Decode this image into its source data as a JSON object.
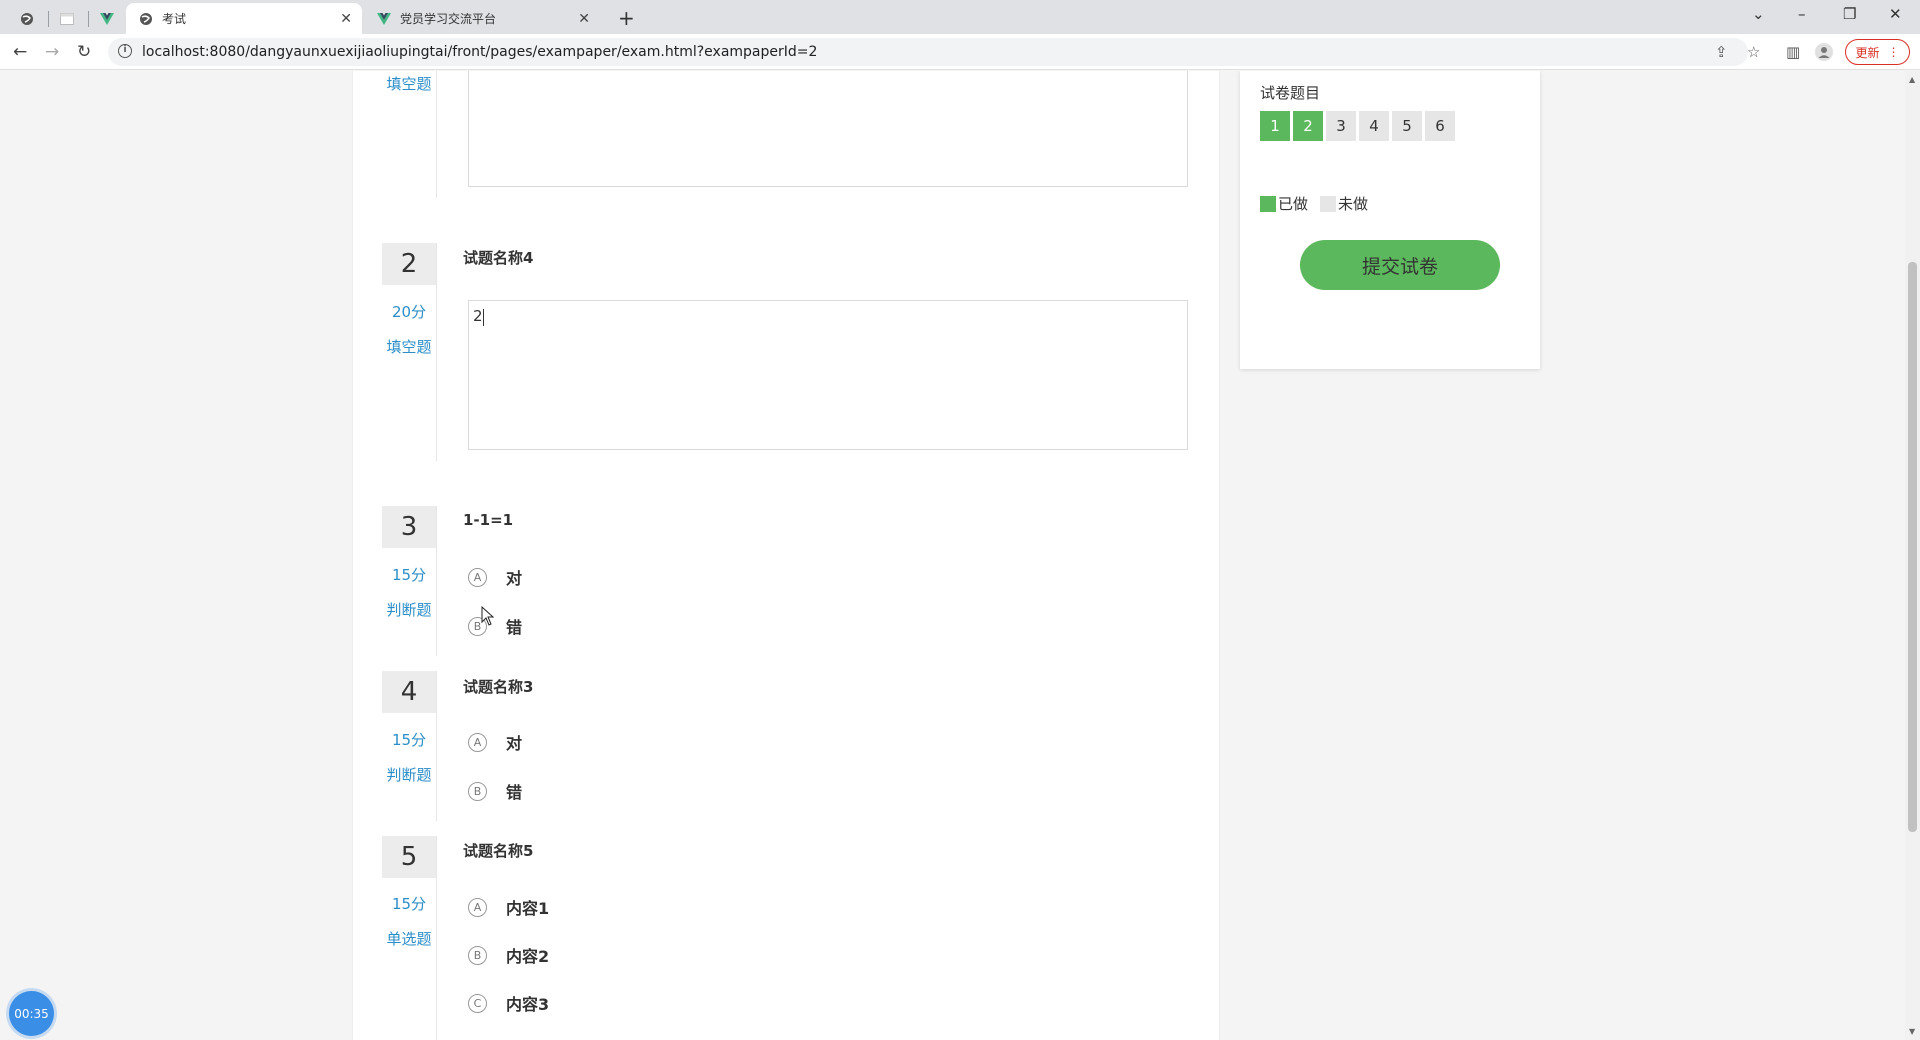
{
  "browser": {
    "tabs": [
      {
        "title": "考试",
        "icon": "globe-icon"
      },
      {
        "title": "党员学习交流平台",
        "icon": "vue-icon"
      }
    ],
    "url": "localhost:8080/dangyaunxuexijiaoliupingtai/front/pages/exampaper/exam.html?exampaperId=2",
    "update_label": "更新"
  },
  "questions": [
    {
      "type_label": "填空题"
    },
    {
      "number": "2",
      "score": "20分",
      "type_label": "填空题",
      "title": "试题名称4",
      "answer": "2"
    },
    {
      "number": "3",
      "score": "15分",
      "type_label": "判断题",
      "title": "1-1=1",
      "options": [
        {
          "letter": "A",
          "label": "对"
        },
        {
          "letter": "B",
          "label": "错"
        }
      ]
    },
    {
      "number": "4",
      "score": "15分",
      "type_label": "判断题",
      "title": "试题名称3",
      "options": [
        {
          "letter": "A",
          "label": "对"
        },
        {
          "letter": "B",
          "label": "错"
        }
      ]
    },
    {
      "number": "5",
      "score": "15分",
      "type_label": "单选题",
      "title": "试题名称5",
      "options": [
        {
          "letter": "A",
          "label": "内容1"
        },
        {
          "letter": "B",
          "label": "内容2"
        },
        {
          "letter": "C",
          "label": "内容3"
        }
      ]
    }
  ],
  "sidebar": {
    "title": "试卷题目",
    "nav": [
      {
        "n": "1",
        "done": true
      },
      {
        "n": "2",
        "done": true
      },
      {
        "n": "3",
        "done": false
      },
      {
        "n": "4",
        "done": false
      },
      {
        "n": "5",
        "done": false
      },
      {
        "n": "6",
        "done": false
      }
    ],
    "legend_done": "已做",
    "legend_todo": "未做",
    "submit_label": "提交试卷",
    "colors": {
      "done": "#5cb85c",
      "todo": "#e6e6e6"
    }
  },
  "timer": "00:35"
}
